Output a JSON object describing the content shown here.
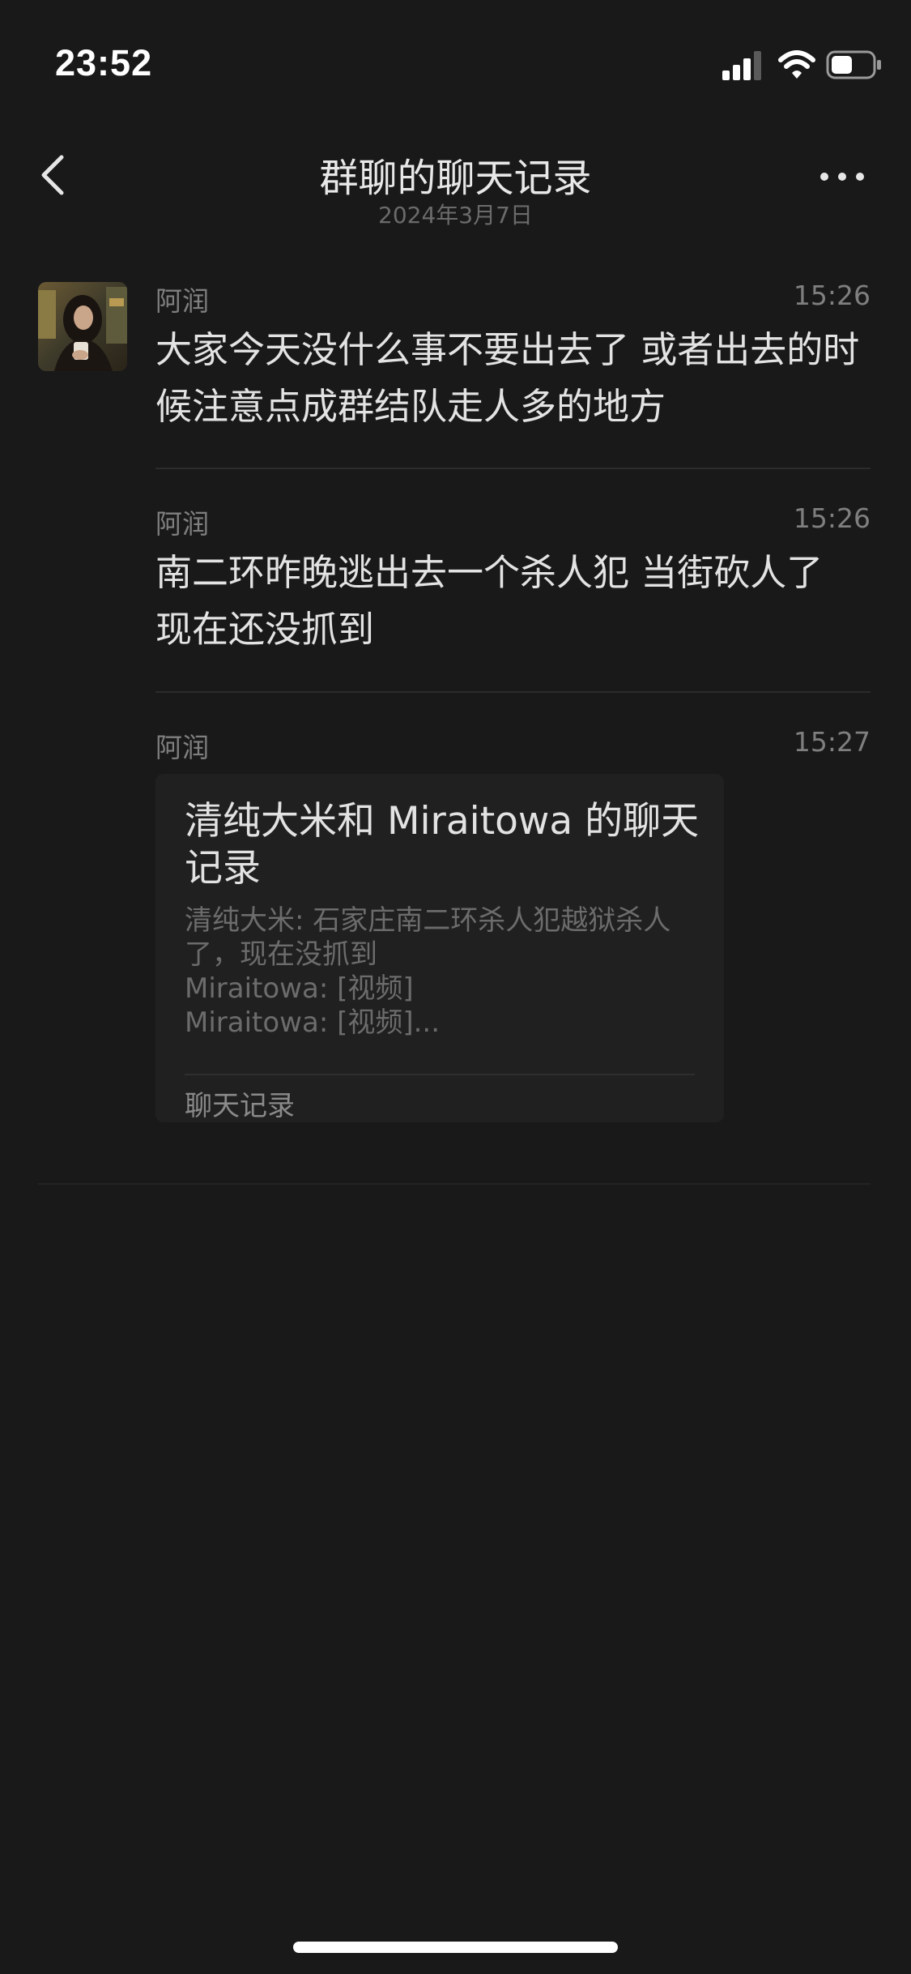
{
  "status_bar": {
    "time": "23:52",
    "icons": [
      "signal-icon",
      "wifi-icon",
      "battery-icon"
    ]
  },
  "nav": {
    "title": "群聊的聊天记录",
    "subtitle": "2024年3月7日",
    "back_icon": "back-chevron-icon",
    "more_icon": "more-dots-icon"
  },
  "messages": [
    {
      "sender": "阿润",
      "time": "15:26",
      "text": "大家今天没什么事不要出去了 或者出去的时候注意点成群结队走人多的地方"
    },
    {
      "sender": "阿润",
      "time": "15:26",
      "text": "南二环昨晚逃出去一个杀人犯 当街砍人了 现在还没抓到"
    },
    {
      "sender": "阿润",
      "time": "15:27",
      "record": {
        "title": "清纯大米和 Miraitowa 的聊天记录",
        "lines": [
          "清纯大米: 石家庄南二环杀人犯越狱杀人了，现在没抓到",
          "Miraitowa: [视频]",
          "Miraitowa: [视频]..."
        ],
        "footer": "聊天记录"
      }
    }
  ],
  "colors": {
    "background": "#191919",
    "card": "#202020",
    "primary_text": "#e3e3e3",
    "secondary_text": "#7f7f7f"
  }
}
